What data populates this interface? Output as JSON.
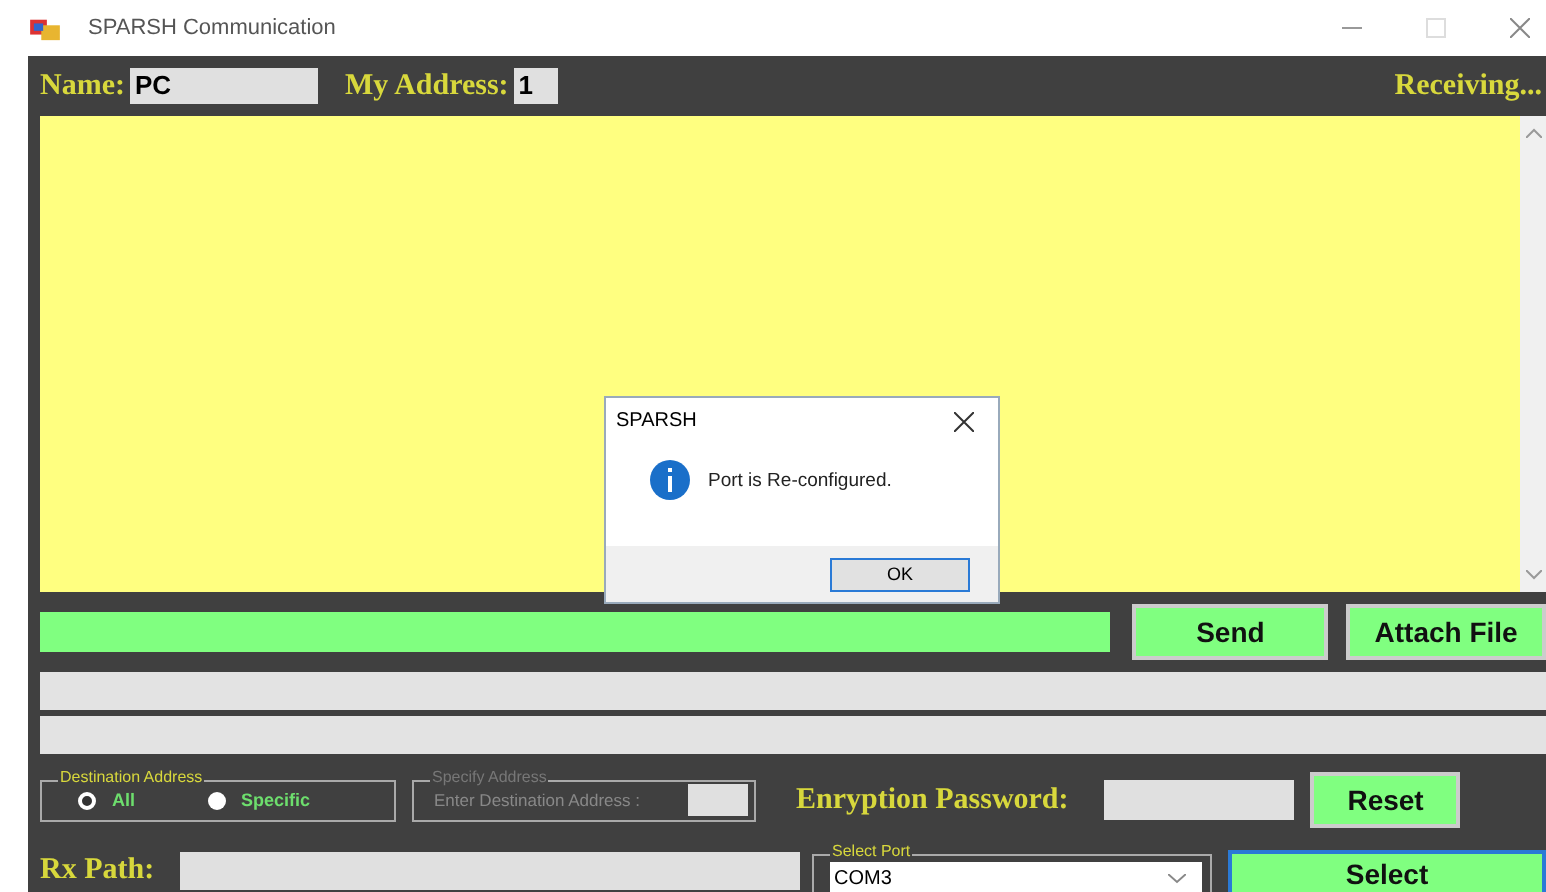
{
  "window": {
    "title": "SPARSH Communication"
  },
  "header": {
    "name_label": "Name:",
    "name_value": "PC",
    "address_label": "My Address:",
    "address_value": "1",
    "status": "Receiving..."
  },
  "dialog": {
    "title": "SPARSH",
    "message": "Port is Re-configured.",
    "button": "OK"
  },
  "send_row": {
    "send_button": "Send",
    "attach_button": "Attach File"
  },
  "destination": {
    "legend": "Destination Address",
    "options": [
      {
        "label": "All",
        "selected": true
      },
      {
        "label": "Specific",
        "selected": false
      }
    ]
  },
  "specify": {
    "legend": "Specify Address",
    "label": "Enter Destination Address :",
    "disabled": true
  },
  "encryption": {
    "label": "Enryption Password:",
    "reset_button": "Reset"
  },
  "rx_path": {
    "label": "Rx Path:"
  },
  "port": {
    "legend": "Select Port",
    "value": "COM3",
    "select_button": "Select"
  }
}
